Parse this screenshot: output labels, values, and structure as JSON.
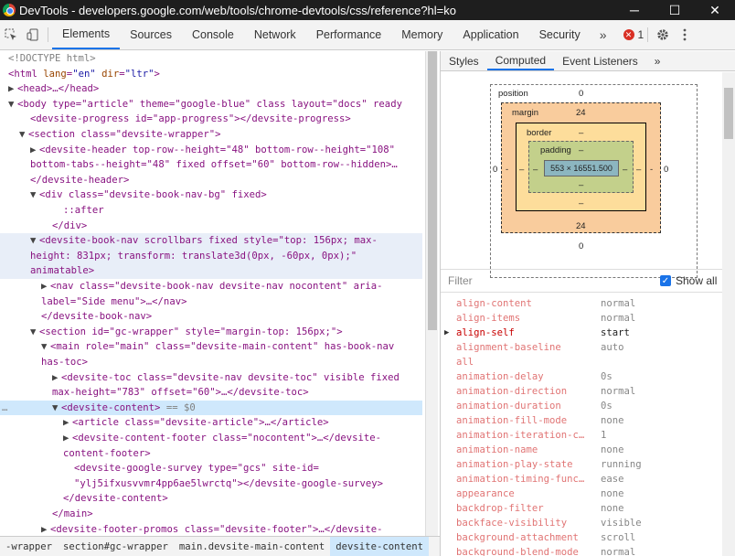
{
  "window": {
    "title": "DevTools - developers.google.com/web/tools/chrome-devtools/css/reference?hl=ko",
    "minimize": "─",
    "maximize": "☐",
    "close": "✕"
  },
  "toolbar": {
    "tabs": [
      "Elements",
      "Sources",
      "Console",
      "Network",
      "Performance",
      "Memory",
      "Application",
      "Security"
    ],
    "more": "»",
    "error_count": "1",
    "settings_icon": "gear-icon",
    "menu_icon": "kebab-icon"
  },
  "elements": {
    "doctype": "<!DOCTYPE html>",
    "html": {
      "tag": "html",
      "lang_attr": "lang",
      "lang": "\"en\"",
      "dir_attr": "dir",
      "dir": "\"ltr\""
    },
    "head": "<head>…</head>",
    "body_line": "<body type=\"article\" theme=\"google-blue\" class layout=\"docs\" ready",
    "progress_line": "<devsite-progress id=\"app-progress\"></devsite-progress>",
    "section1": "<section class=\"devsite-wrapper\">",
    "header_line1": "<devsite-header top-row--height=\"48\" bottom-row--height=\"108\"",
    "header_line2": "bottom-tabs--height=\"48\" fixed offset=\"60\" bottom-row--hidden>…",
    "header_close": "</devsite-header>",
    "navbg": "<div class=\"devsite-book-nav-bg\" fixed>",
    "after": "::after",
    "div_close": "</div>",
    "booknav_line1": "<devsite-book-nav scrollbars fixed style=\"top: 156px; max-",
    "booknav_line2": "height: 831px; transform: translate3d(0px, -60px, 0px);\"",
    "booknav_line3": "animatable>",
    "nav_line1": "<nav class=\"devsite-book-nav devsite-nav nocontent\" aria-",
    "nav_line2": "label=\"Side menu\">…</nav>",
    "booknav_close": "</devsite-book-nav>",
    "section2": "<section id=\"gc-wrapper\" style=\"margin-top: 156px;\">",
    "main_line1": "<main role=\"main\" class=\"devsite-main-content\" has-book-nav",
    "main_line2": "has-toc>",
    "toc_line1": "<devsite-toc class=\"devsite-nav devsite-toc\" visible fixed",
    "toc_line2": "max-height=\"783\" offset=\"60\">…</devsite-toc>",
    "content_line": "<devsite-content>",
    "content_eq": " == $0",
    "article_line": "<article class=\"devsite-article\">…</article>",
    "footer_line1": "<devsite-content-footer class=\"nocontent\">…</devsite-",
    "footer_line2": "content-footer>",
    "survey_line1": "<devsite-google-survey type=\"gcs\" site-id=",
    "survey_line2": "\"ylj5ifxusvvmr4pp6ae5lwrctq\"></devsite-google-survey>",
    "content_close": "</devsite-content>",
    "main_close": "</main>",
    "promos_line": "<devsite-footer-promos class=\"devsite-footer\">…</devsite-",
    "dots": "…"
  },
  "breadcrumbs": [
    "-wrapper",
    "section#gc-wrapper",
    "main.devsite-main-content",
    "devsite-content"
  ],
  "styles_panel": {
    "tabs": [
      "Styles",
      "Computed",
      "Event Listeners"
    ],
    "more": "»",
    "box_model": {
      "position_label": "position",
      "position_top": "0",
      "position_left": "0",
      "position_right": "0",
      "position_bottom": "0",
      "margin_label": "margin",
      "margin_top": "24",
      "margin_left": "-",
      "margin_right": "-",
      "margin_bottom": "24",
      "border_label": "border",
      "border_top": "–",
      "border_left": "–",
      "border_right": "–",
      "border_bottom": "–",
      "padding_label": "padding",
      "padding_top": "–",
      "padding_left": "–",
      "padding_right": "–",
      "padding_bottom": "–",
      "content": "553 × 16551.500"
    },
    "filter_placeholder": "Filter",
    "show_all": "Show all",
    "properties": [
      {
        "name": "align-content",
        "value": "normal",
        "active": false
      },
      {
        "name": "align-items",
        "value": "normal",
        "active": false
      },
      {
        "name": "align-self",
        "value": "start",
        "active": true
      },
      {
        "name": "alignment-baseline",
        "value": "auto",
        "active": false
      },
      {
        "name": "all",
        "value": "",
        "active": false
      },
      {
        "name": "animation-delay",
        "value": "0s",
        "active": false
      },
      {
        "name": "animation-direction",
        "value": "normal",
        "active": false
      },
      {
        "name": "animation-duration",
        "value": "0s",
        "active": false
      },
      {
        "name": "animation-fill-mode",
        "value": "none",
        "active": false
      },
      {
        "name": "animation-iteration-c…",
        "value": "1",
        "active": false
      },
      {
        "name": "animation-name",
        "value": "none",
        "active": false
      },
      {
        "name": "animation-play-state",
        "value": "running",
        "active": false
      },
      {
        "name": "animation-timing-func…",
        "value": "ease",
        "active": false
      },
      {
        "name": "appearance",
        "value": "none",
        "active": false
      },
      {
        "name": "backdrop-filter",
        "value": "none",
        "active": false
      },
      {
        "name": "backface-visibility",
        "value": "visible",
        "active": false
      },
      {
        "name": "background-attachment",
        "value": "scroll",
        "active": false
      },
      {
        "name": "background-blend-mode",
        "value": "normal",
        "active": false
      }
    ]
  },
  "colors": {
    "accent": "#1a73e8",
    "tag": "#881280",
    "attr": "#994500",
    "value": "#1a1aa6",
    "prop_name": "#c80000"
  }
}
